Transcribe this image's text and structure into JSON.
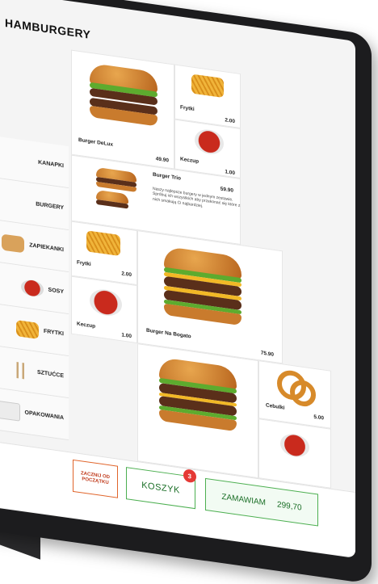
{
  "header": {
    "title": "HAMBURGERY"
  },
  "sidebar": {
    "items": [
      {
        "label": "KANAPKI",
        "icon": "sandwich-icon"
      },
      {
        "label": "BURGERY",
        "icon": "burger-icon"
      },
      {
        "label": "ZAPIEKANKI",
        "icon": "baguette-icon"
      },
      {
        "label": "SOSY",
        "icon": "sauce-icon"
      },
      {
        "label": "FRYTKI",
        "icon": "fries-icon"
      },
      {
        "label": "SZTUĆCE",
        "icon": "cutlery-icon"
      },
      {
        "label": "OPAKOWANIA",
        "icon": "box-icon"
      }
    ]
  },
  "products": [
    {
      "name": "Burger DeLux",
      "price": "49.90"
    },
    {
      "name": "Frytki",
      "price": "2.00"
    },
    {
      "name": "Keczup",
      "price": "1.00"
    },
    {
      "name": "Burger Trio",
      "price": "59.90",
      "description": "Naszy najlepsze burgery w jednym zestawie. Spróbuj ich wszystkich aby przekonać się które z nich smakują Ci najbardziej."
    },
    {
      "name": "Frytki",
      "price": "2.00"
    },
    {
      "name": "Keczup",
      "price": "1.00"
    },
    {
      "name": "Burger Na Bogato",
      "price": "75.90"
    },
    {
      "name": "Cebulki",
      "price": "5.00"
    }
  ],
  "footer": {
    "start_over_label": "ZACZNIJ OD POCZĄTKU",
    "cart_label": "KOSZYK",
    "cart_count": "3",
    "order_label": "ZAMAWIAM",
    "order_total": "299,70"
  },
  "colors": {
    "accent_green": "#4caf50",
    "accent_orange": "#e0642a",
    "badge_red": "#e53935"
  }
}
